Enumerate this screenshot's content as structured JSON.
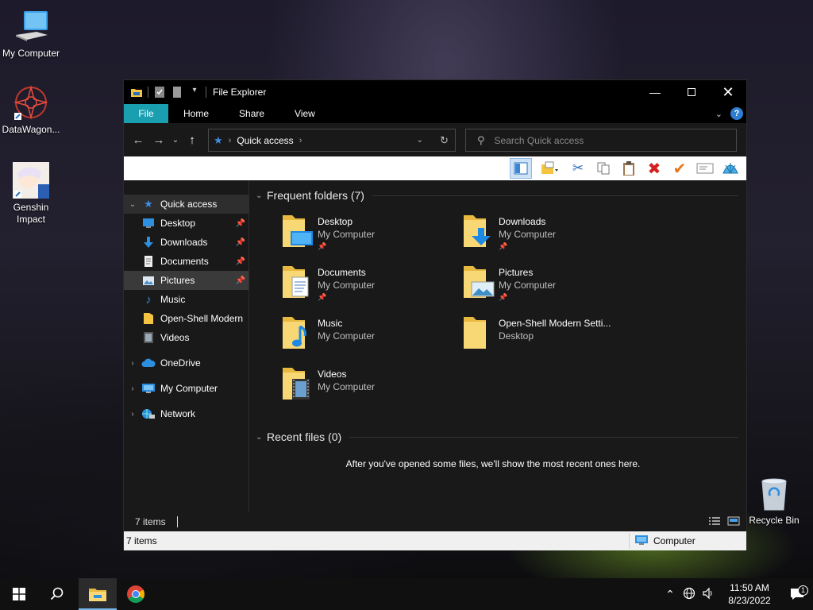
{
  "desktop": {
    "icons": [
      {
        "label": "My Computer"
      },
      {
        "label": "DataWagon..."
      },
      {
        "label": "Genshin Impact"
      },
      {
        "label": "Recycle Bin"
      }
    ]
  },
  "window": {
    "title": "File Explorer",
    "ribbon_tabs": [
      "File",
      "Home",
      "Share",
      "View"
    ],
    "address": {
      "crumb": "Quick access"
    },
    "search": {
      "placeholder": "Search Quick access"
    },
    "nav": {
      "quick_access": "Quick access",
      "items": [
        "Desktop",
        "Downloads",
        "Documents",
        "Pictures",
        "Music",
        "Open-Shell Modern",
        "Videos"
      ],
      "roots": [
        "OneDrive",
        "My Computer",
        "Network"
      ]
    },
    "frequent": {
      "heading": "Frequent folders (7)",
      "folders": [
        {
          "name": "Desktop",
          "location": "My Computer"
        },
        {
          "name": "Downloads",
          "location": "My Computer"
        },
        {
          "name": "Documents",
          "location": "My Computer"
        },
        {
          "name": "Pictures",
          "location": "My Computer"
        },
        {
          "name": "Music",
          "location": "My Computer"
        },
        {
          "name": "Open-Shell Modern Setti...",
          "location": "Desktop"
        },
        {
          "name": "Videos",
          "location": "My Computer"
        }
      ]
    },
    "recent": {
      "heading": "Recent files (0)",
      "message": "After you've opened some files, we'll show the most recent ones here."
    },
    "status": {
      "items": "7 items",
      "items2": "7 items",
      "zone": "Computer"
    }
  },
  "taskbar": {
    "time": "11:50 AM",
    "date": "8/23/2022",
    "notification_count": "1"
  },
  "colors": {
    "file_tab": "#1a9fb0",
    "accent": "#3f8fe3"
  }
}
